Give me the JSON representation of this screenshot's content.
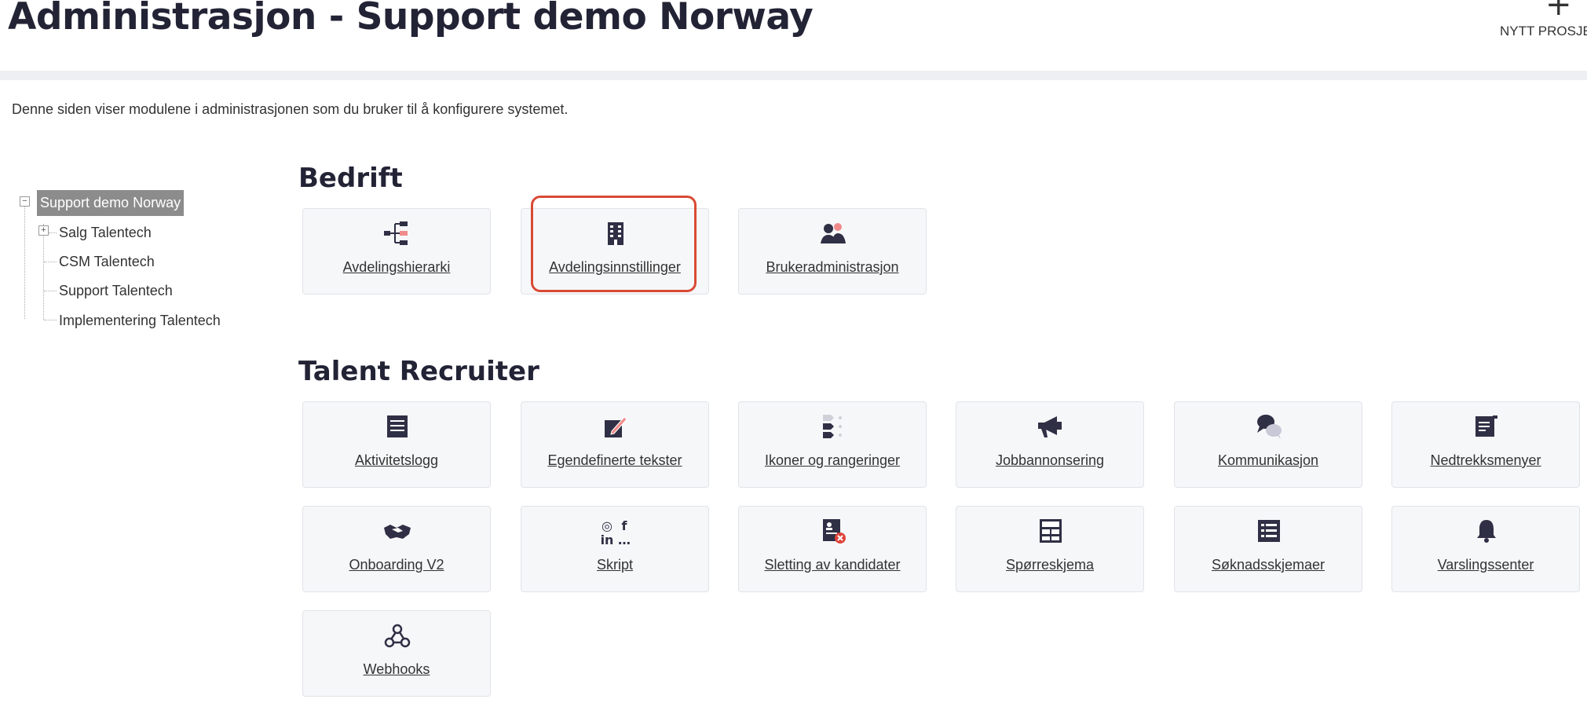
{
  "header": {
    "title": "Administrasjon - Support demo Norway",
    "new_project_label": "NYTT PROSJEKT",
    "new_project_icon": "plus-icon"
  },
  "intro_text": "Denne siden viser modulene i administrasjonen som du bruker til å konfigurere systemet.",
  "tree": {
    "root": "Support demo Norway",
    "children": [
      "Salg Talentech",
      "CSM Talentech",
      "Support Talentech",
      "Implementering Talentech"
    ]
  },
  "sections": {
    "bedrift": {
      "title": "Bedrift",
      "cards": [
        {
          "label": "Avdelingshierarki",
          "icon": "hierarchy-icon"
        },
        {
          "label": "Avdelingsinnstillinger",
          "icon": "building-icon"
        },
        {
          "label": "Brukeradministrasjon",
          "icon": "users-icon"
        }
      ]
    },
    "talent": {
      "title": "Talent Recruiter",
      "cards": [
        {
          "label": "Aktivitetslogg",
          "icon": "log-icon"
        },
        {
          "label": "Egendefinerte tekster",
          "icon": "edit-icon"
        },
        {
          "label": "Ikoner og rangeringer",
          "icon": "ranking-icon"
        },
        {
          "label": "Jobbannonsering",
          "icon": "megaphone-icon"
        },
        {
          "label": "Kommunikasjon",
          "icon": "chat-icon"
        },
        {
          "label": "Nedtrekksmenyer",
          "icon": "dropdown-icon"
        },
        {
          "label": "Onboarding V2",
          "icon": "handshake-icon"
        },
        {
          "label": "Skript",
          "icon": "social-icon"
        },
        {
          "label": "Sletting av kandidater",
          "icon": "delete-candidate-icon"
        },
        {
          "label": "Spørreskjema",
          "icon": "questionnaire-icon"
        },
        {
          "label": "Søknadsskjemaer",
          "icon": "form-icon"
        },
        {
          "label": "Varslingssenter",
          "icon": "bell-icon"
        },
        {
          "label": "Webhooks",
          "icon": "webhook-icon"
        }
      ]
    }
  },
  "colors": {
    "title": "#232336",
    "card_bg": "#f6f7f9",
    "highlight": "#d94a34",
    "tree_selected": "#8c8c8c",
    "icon": "#2f2f45",
    "accent_pink": "#f08a8a"
  },
  "skript_icon_text": {
    "instagram": "◎",
    "facebook": "f",
    "linkedin": "in",
    "more": "…"
  }
}
